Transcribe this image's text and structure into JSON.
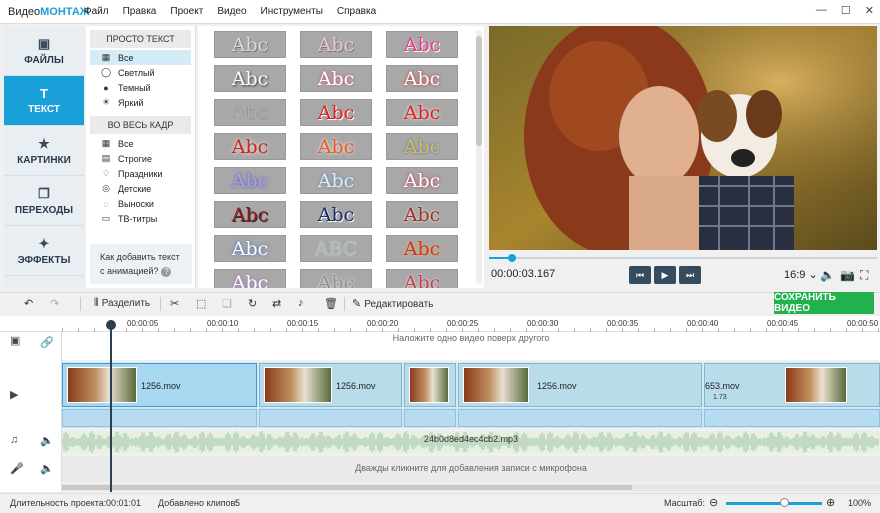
{
  "app": {
    "title_prefix": "Видео",
    "title_brand": "МОНТАЖ"
  },
  "menu": [
    "Файл",
    "Правка",
    "Проект",
    "Видео",
    "Инструменты",
    "Справка"
  ],
  "window_controls": [
    "—",
    "☐",
    "✕"
  ],
  "sidebar": [
    {
      "label": "ФАЙЛЫ",
      "icon": "image-icon",
      "glyph": "▣"
    },
    {
      "label": "ТЕКСТ",
      "icon": "text-icon",
      "glyph": "T",
      "active": true
    },
    {
      "label": "КАРТИНКИ",
      "icon": "star-icon",
      "glyph": "★"
    },
    {
      "label": "ПЕРЕХОДЫ",
      "icon": "transitions-icon",
      "glyph": "❐"
    },
    {
      "label": "ЭФФЕКТЫ",
      "icon": "wand-icon",
      "glyph": "✦"
    }
  ],
  "categories": {
    "group1": {
      "title": "ПРОСТО ТЕКСТ",
      "items": [
        {
          "label": "Все",
          "glyph": "▦",
          "selected": true
        },
        {
          "label": "Светлый",
          "glyph": "◯"
        },
        {
          "label": "Темный",
          "glyph": "●"
        },
        {
          "label": "Яркий",
          "glyph": "☀"
        }
      ]
    },
    "group2": {
      "title": "ВО ВЕСЬ КАДР",
      "items": [
        {
          "label": "Все",
          "glyph": "▦"
        },
        {
          "label": "Строгие",
          "glyph": "▤"
        },
        {
          "label": "Праздники",
          "glyph": "♢"
        },
        {
          "label": "Детские",
          "glyph": "◎"
        },
        {
          "label": "Выноски",
          "glyph": "◌"
        },
        {
          "label": "ТВ-титры",
          "glyph": "▭"
        }
      ]
    },
    "help": {
      "line1": "Как добавить текст",
      "line2": "с анимацией?",
      "q": "?"
    }
  },
  "text_styles": [
    {
      "text": "Abc",
      "color": "#d8d8d8",
      "shadow": "1px 1px 0 #777"
    },
    {
      "text": "Abc",
      "color": "#e8c6d8",
      "shadow": "1px 1px 0 #777"
    },
    {
      "text": "Abc",
      "color": "#e63e8c",
      "shadow": "1px 1px 0 #fff"
    },
    {
      "text": "Abc",
      "color": "#ffffff",
      "shadow": "1px 1px 2px #333"
    },
    {
      "text": "Abc",
      "color": "#ffffff",
      "shadow": "0 0 3px #e0307e"
    },
    {
      "text": "Abc",
      "color": "#ffffff",
      "shadow": "0 0 3px #c01818"
    },
    {
      "text": "Abc",
      "color": "#b0b0b0",
      "shadow": "0 0 0 #000"
    },
    {
      "text": "Abc",
      "color": "#e41f1f",
      "shadow": "1px 1px 0 #fff"
    },
    {
      "text": "Abc",
      "color": "#e41f1f",
      "shadow": "0 0 3px #fff"
    },
    {
      "text": "Abc",
      "color": "#d42020",
      "shadow": "0 0 4px #fff"
    },
    {
      "text": "Abc",
      "color": "#f05a1e",
      "shadow": "0 0 3px #fff"
    },
    {
      "text": "Abc",
      "color": "#d8c040",
      "shadow": "0 0 2px #4060d0"
    },
    {
      "text": "Abc",
      "color": "#9aa8e8",
      "shadow": "0 0 3px #6040a0"
    },
    {
      "text": "Abc",
      "color": "#e8e8e8",
      "shadow": "0 0 3px #5080c0"
    },
    {
      "text": "Abc",
      "color": "#ffffff",
      "shadow": "0 0 3px #c02040"
    },
    {
      "text": "Abc",
      "color": "#8c1a1a",
      "shadow": "1px 1px 0 #333"
    },
    {
      "text": "Abc",
      "color": "#1a2a6a",
      "shadow": "1px 1px 0 #fff"
    },
    {
      "text": "Abc",
      "color": "#9a3020",
      "shadow": "0 0 2px #fff"
    },
    {
      "text": "Abc",
      "color": "#ffffff",
      "shadow": "0 0 3px #3060c0"
    },
    {
      "text": "ABC",
      "color": "#a8b8b8",
      "shadow": "0 0 1px #fff"
    },
    {
      "text": "Abc",
      "color": "#c83050",
      "shadow": "0 0 2px #ffd000"
    },
    {
      "text": "Abc",
      "color": "#ffffff",
      "shadow": "0 0 3px #a060d0"
    },
    {
      "text": "Abc",
      "color": "#909090",
      "shadow": "0 0 2px #fff"
    },
    {
      "text": "Abc",
      "color": "#c04050",
      "shadow": "0 0 2px #fff"
    }
  ],
  "player": {
    "timecode": "00:00:03.167",
    "progress": 0.06,
    "aspect": "16:9",
    "aspect_caret": "⌄",
    "controls": [
      {
        "name": "prev-frame-button",
        "glyph": "⏮"
      },
      {
        "name": "play-button",
        "glyph": "▶"
      },
      {
        "name": "next-frame-button",
        "glyph": "⏭"
      }
    ],
    "tools": [
      {
        "name": "volume-icon",
        "glyph": "🔈"
      },
      {
        "name": "snapshot-icon",
        "glyph": "📷"
      },
      {
        "name": "fullscreen-icon",
        "glyph": "⛶"
      }
    ]
  },
  "toolbar": {
    "undo": "↶",
    "redo": "↷",
    "split_icon": "⫴",
    "split": "Разделить",
    "cut": "✂",
    "crop": "⬚",
    "copy": "❑",
    "rotate": "↻",
    "replace": "⇄",
    "sound": "♪",
    "delete": "🗑",
    "edit_icon": "✎",
    "edit": "Редактировать",
    "save": "СОХРАНИТЬ ВИДЕО"
  },
  "ruler": [
    "00:00:05",
    "00:00:10",
    "00:00:15",
    "00:00:20",
    "00:00:25",
    "00:00:30",
    "00:00:35",
    "00:00:40",
    "00:00:45",
    "00:00:50"
  ],
  "tracks": {
    "overlay_hint": "Наложите одно видео поверх другого",
    "clips": [
      {
        "name": "1256.mov",
        "selected": true
      },
      {
        "name": "1256.mov"
      },
      {
        "name": ""
      },
      {
        "name": "1256.mov"
      },
      {
        "name": "653.mov",
        "thumb_label": "1.73"
      }
    ],
    "audio_name": "24b0d8ed4ec4cb2.mp3",
    "mic_hint": "Дважды кликните для добавления записи с микрофона",
    "header_icons": [
      {
        "name": "overlay-icon",
        "glyph": "▣"
      },
      {
        "name": "link-icon",
        "glyph": "🔗"
      },
      {
        "name": "video-camera-icon",
        "glyph": "▶"
      },
      {
        "name": "music-note-icon",
        "glyph": "♫"
      },
      {
        "name": "speaker-icon",
        "glyph": "🔈"
      },
      {
        "name": "microphone-icon",
        "glyph": "🎤"
      },
      {
        "name": "mic-speaker-icon",
        "glyph": "🔈"
      }
    ]
  },
  "status": {
    "duration_label": "Длительность проекта:",
    "duration": "00:01:01",
    "clips_label": "Добавлено клипов:",
    "clips": "5",
    "zoom_label": "Масштаб:",
    "zoom_minus": "⊖",
    "zoom_plus": "⊕",
    "zoom_value": "100%",
    "zoom_level": 0.6
  },
  "colors": {
    "accent": "#1a9fd6",
    "save": "#22b14c",
    "playbar": "#354b60"
  }
}
